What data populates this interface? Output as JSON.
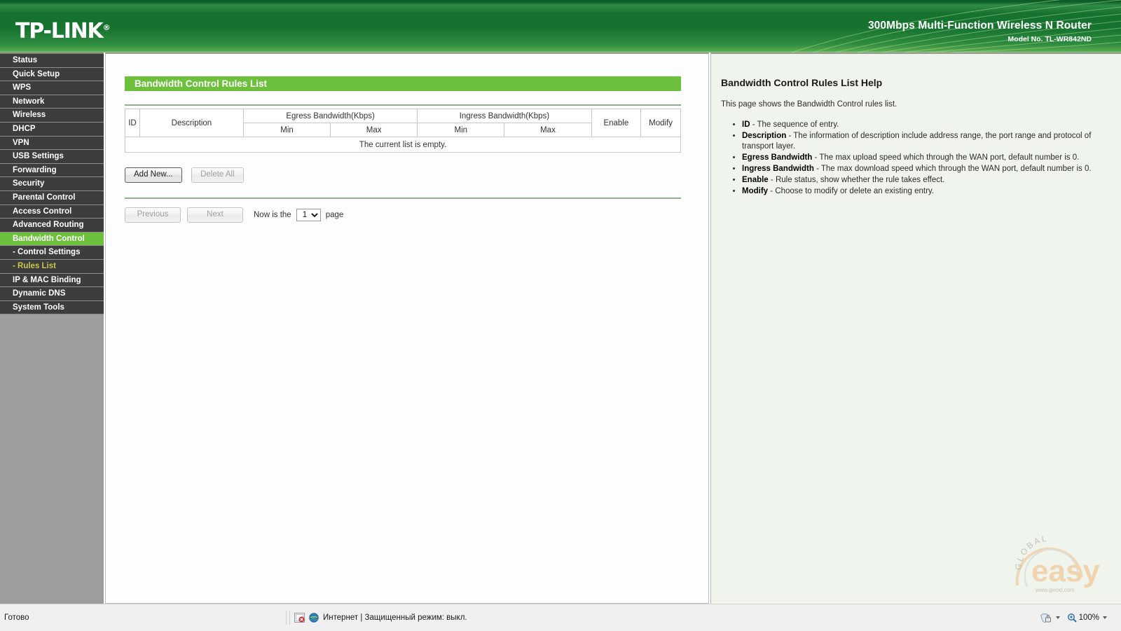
{
  "banner": {
    "logo_text": "TP-LINK",
    "logo_registered": "®",
    "product_title": "300Mbps Multi-Function Wireless N Router",
    "model_label": "Model No. TL-WR842ND"
  },
  "sidebar": {
    "items": [
      {
        "label": "Status",
        "state": "normal"
      },
      {
        "label": "Quick Setup",
        "state": "normal"
      },
      {
        "label": "WPS",
        "state": "normal"
      },
      {
        "label": "Network",
        "state": "normal"
      },
      {
        "label": "Wireless",
        "state": "normal"
      },
      {
        "label": "DHCP",
        "state": "normal"
      },
      {
        "label": "VPN",
        "state": "normal"
      },
      {
        "label": "USB Settings",
        "state": "normal"
      },
      {
        "label": "Forwarding",
        "state": "normal"
      },
      {
        "label": "Security",
        "state": "normal"
      },
      {
        "label": "Parental Control",
        "state": "normal"
      },
      {
        "label": "Access Control",
        "state": "normal"
      },
      {
        "label": "Advanced Routing",
        "state": "normal"
      },
      {
        "label": "Bandwidth Control",
        "state": "active"
      },
      {
        "label": "- Control Settings",
        "state": "sub"
      },
      {
        "label": "- Rules List",
        "state": "sub-active"
      },
      {
        "label": "IP & MAC Binding",
        "state": "normal"
      },
      {
        "label": "Dynamic DNS",
        "state": "normal"
      },
      {
        "label": "System Tools",
        "state": "normal"
      }
    ]
  },
  "main": {
    "page_title": "Bandwidth Control Rules List",
    "table": {
      "headers": {
        "id": "ID",
        "description": "Description",
        "egress": "Egress Bandwidth(Kbps)",
        "ingress": "Ingress Bandwidth(Kbps)",
        "egress_min": "Min",
        "egress_max": "Max",
        "ingress_min": "Min",
        "ingress_max": "Max",
        "enable": "Enable",
        "modify": "Modify"
      },
      "rows": [],
      "empty_message": "The current list is empty."
    },
    "buttons": {
      "add_new": "Add New...",
      "delete_all": "Delete All"
    },
    "pager": {
      "previous": "Previous",
      "next": "Next",
      "prefix": "Now is the",
      "current_page": "1",
      "page_options": [
        "1"
      ],
      "suffix": "page"
    }
  },
  "help": {
    "title": "Bandwidth Control Rules List Help",
    "intro": "This page shows the Bandwidth Control rules list.",
    "items": [
      {
        "term": "ID",
        "desc": " - The sequence of entry."
      },
      {
        "term": "Description",
        "desc": " - The information of description include address range, the port range and protocol of transport layer."
      },
      {
        "term": "Egress Bandwidth",
        "desc": " - The max upload speed which through the WAN port, default number is 0."
      },
      {
        "term": "Ingress Bandwidth",
        "desc": " - The max download speed which through the WAN port, default number is 0."
      },
      {
        "term": "Enable",
        "desc": " - Rule status, show whether the rule takes effect."
      },
      {
        "term": "Modify",
        "desc": " - Choose to modify or delete an existing entry."
      }
    ]
  },
  "watermark": {
    "arc_text": "GLOBAL",
    "brand": "easy",
    "url": "www.gecid.com"
  },
  "statusbar": {
    "ready_text": "Готово",
    "zone_text": "Интернет | Защищенный режим: выкл.",
    "zoom_level": "100%"
  },
  "colors": {
    "brand_green": "#6dc03c",
    "banner_dark": "#15722f",
    "sidebar_item": "#3d3d3d",
    "sub_active": "#c9c64a",
    "help_bg": "#eff4ec"
  }
}
